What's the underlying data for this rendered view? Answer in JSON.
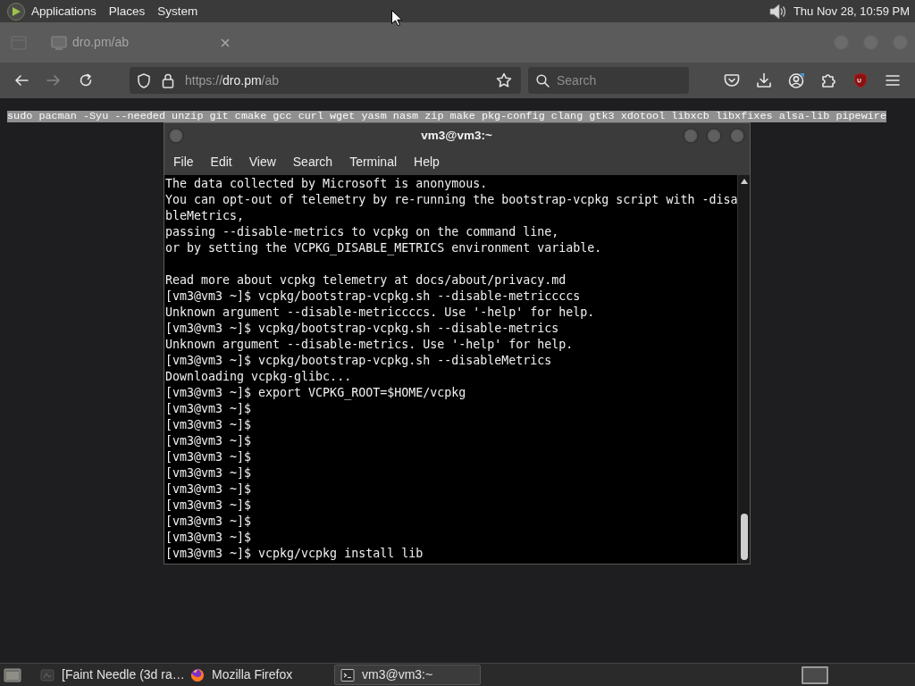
{
  "top_panel": {
    "menus": [
      "Applications",
      "Places",
      "System"
    ],
    "clock": "Thu Nov 28, 10:59 PM"
  },
  "browser": {
    "tabs": [
      {
        "title": "dro.pm/ab"
      }
    ],
    "nav_buttons": [
      {
        "kind": "back",
        "disabled": false
      },
      {
        "kind": "forward",
        "disabled": true
      },
      {
        "kind": "reload",
        "disabled": false
      }
    ],
    "address": {
      "scheme": "https://",
      "host": "dro.pm",
      "path": "/ab"
    },
    "search": {
      "placeholder": "Search"
    },
    "page": {
      "selected_text": "sudo pacman -Syu --needed unzip git cmake gcc curl wget yasm nasm zip make pkg-config clang gtk3 xdotool libxcb libxfixes alsa-lib pipewire"
    }
  },
  "terminal": {
    "title": "vm3@vm3:~",
    "menus": [
      "File",
      "Edit",
      "View",
      "Search",
      "Terminal",
      "Help"
    ],
    "output_blocks": [
      [
        "The data collected by Microsoft is anonymous.",
        "You can opt-out of telemetry by re-running the bootstrap-vcpkg script with -disa",
        "bleMetrics,",
        "passing --disable-metrics to vcpkg on the command line,",
        "or by setting the VCPKG_DISABLE_METRICS environment variable."
      ],
      [
        "Read more about vcpkg telemetry at docs/about/privacy.md",
        "[vm3@vm3 ~]$ vcpkg/bootstrap-vcpkg.sh --disable-metriccccs",
        "Unknown argument --disable-metriccccs. Use '-help' for help.",
        "[vm3@vm3 ~]$ vcpkg/bootstrap-vcpkg.sh --disable-metrics",
        "Unknown argument --disable-metrics. Use '-help' for help.",
        "[vm3@vm3 ~]$ vcpkg/bootstrap-vcpkg.sh --disableMetrics",
        "Downloading vcpkg-glibc...",
        "[vm3@vm3 ~]$ export VCPKG_ROOT=$HOME/vcpkg",
        "[vm3@vm3 ~]$",
        "[vm3@vm3 ~]$",
        "[vm3@vm3 ~]$",
        "[vm3@vm3 ~]$",
        "[vm3@vm3 ~]$",
        "[vm3@vm3 ~]$",
        "[vm3@vm3 ~]$",
        "[vm3@vm3 ~]$",
        "[vm3@vm3 ~]$",
        "[vm3@vm3 ~]$ vcpkg/vcpkg install lib"
      ]
    ]
  },
  "taskbar": {
    "tasks": [
      {
        "kind": "generic",
        "title": "[Faint Needle (3d ra…",
        "selected": false
      },
      {
        "kind": "browser",
        "title": "Mozilla Firefox",
        "selected": false
      },
      {
        "kind": "terminal",
        "title": "vm3@vm3:~",
        "selected": true
      }
    ]
  }
}
